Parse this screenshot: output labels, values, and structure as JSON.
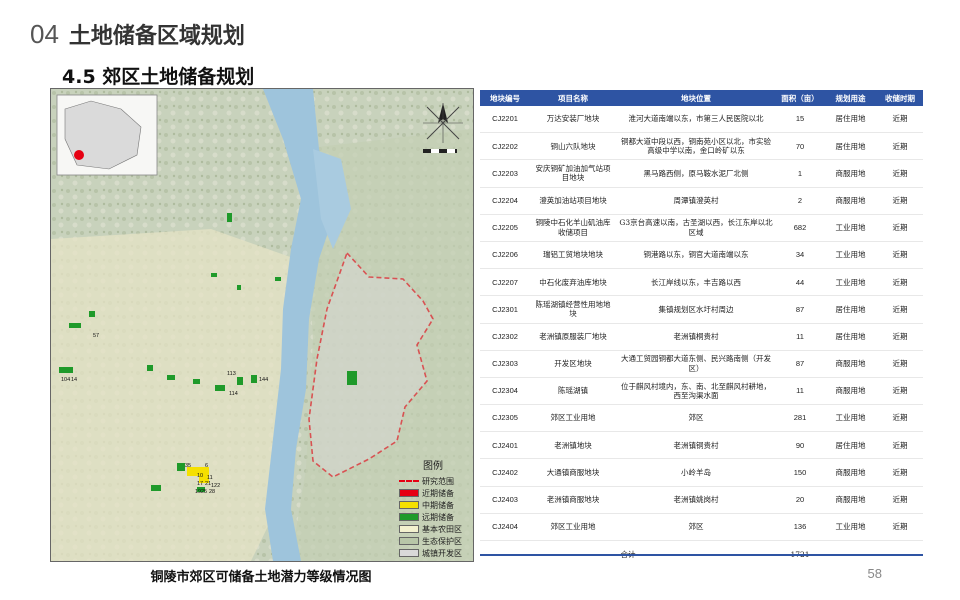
{
  "header": {
    "section_number": "04",
    "section_title": "土地储备区域规划",
    "subtitle": "4.5 郊区土地储备规划"
  },
  "map": {
    "caption": "铜陵市郊区可储备土地潜力等级情况图",
    "parcel_labels": [
      "35",
      "6",
      "10",
      "11",
      "17",
      "21",
      "19",
      "122",
      "25",
      "28",
      "14",
      "104",
      "113",
      "114",
      "57",
      "144"
    ],
    "legend": {
      "title": "图例",
      "items": [
        {
          "label": "研究范围",
          "color": "#e60012",
          "style": "dashed"
        },
        {
          "label": "近期储备",
          "color": "#e60012",
          "style": "fill"
        },
        {
          "label": "中期储备",
          "color": "#f5e000",
          "style": "fill"
        },
        {
          "label": "远期储备",
          "color": "#1f9a2a",
          "style": "fill"
        },
        {
          "label": "基本农田区",
          "color": "#f3f1cf",
          "style": "fill"
        },
        {
          "label": "生态保护区",
          "color": "#b8c6a8",
          "style": "fill"
        },
        {
          "label": "城镇开发区",
          "color": "#d9d9d9",
          "style": "fill"
        }
      ]
    }
  },
  "table": {
    "headers": [
      "地块编号",
      "项目名称",
      "地块位置",
      "面积（亩）",
      "规划用途",
      "收储时期"
    ],
    "rows": [
      {
        "code": "CJ2201",
        "name": "万达安装厂地块",
        "location": "淮河大道南端以东，市第三人民医院以北",
        "area": "15",
        "use": "居住用地",
        "period": "近期"
      },
      {
        "code": "CJ2202",
        "name": "铜山六队地块",
        "location": "铜都大道中段以西，铜南苑小区以北，市实验高级中学以南，金口岭矿以东",
        "area": "70",
        "use": "居住用地",
        "period": "近期"
      },
      {
        "code": "CJ2203",
        "name": "安庆铜矿加油加气站项目地块",
        "location": "黑马路西侧，原马鞍水泥厂北侧",
        "area": "1",
        "use": "商服用地",
        "period": "近期"
      },
      {
        "code": "CJ2204",
        "name": "澄英加油站项目地块",
        "location": "周潭镇澄英村",
        "area": "2",
        "use": "商服用地",
        "period": "近期"
      },
      {
        "code": "CJ2205",
        "name": "铜陵中石化羊山矶油库收储项目",
        "location": "G3京台高速以南，古圣湖以西，长江东岸以北区域",
        "area": "682",
        "use": "工业用地",
        "period": "近期"
      },
      {
        "code": "CJ2206",
        "name": "瑞铝工贸地块地块",
        "location": "铜港路以东，铜官大道南端以东",
        "area": "34",
        "use": "工业用地",
        "period": "近期"
      },
      {
        "code": "CJ2207",
        "name": "中石化废弃油库地块",
        "location": "长江岸线以东，丰吉路以西",
        "area": "44",
        "use": "工业用地",
        "period": "近期"
      },
      {
        "code": "CJ2301",
        "name": "陈瑶湖镇经营性用地地块",
        "location": "集镇规划区水圩村周边",
        "area": "87",
        "use": "居住用地",
        "period": "近期"
      },
      {
        "code": "CJ2302",
        "name": "老洲镇原服装厂地块",
        "location": "老洲镇桐贵村",
        "area": "11",
        "use": "居住用地",
        "period": "近期"
      },
      {
        "code": "CJ2303",
        "name": "开发区地块",
        "location": "大通工贸园铜都大道东侧、民兴路南侧（开发区）",
        "area": "87",
        "use": "商服用地",
        "period": "近期"
      },
      {
        "code": "CJ2304",
        "name": "陈瑶湖镇",
        "location": "位于麒风村境内，东、南、北至麒风村耕地，西至沟渠水面",
        "area": "11",
        "use": "商服用地",
        "period": "近期"
      },
      {
        "code": "CJ2305",
        "name": "郊区工业用地",
        "location": "郊区",
        "area": "281",
        "use": "工业用地",
        "period": "近期"
      },
      {
        "code": "CJ2401",
        "name": "老洲镇地块",
        "location": "老洲镇铜贵村",
        "area": "90",
        "use": "居住用地",
        "period": "近期"
      },
      {
        "code": "CJ2402",
        "name": "大通镇商服地块",
        "location": "小岭羊岛",
        "area": "150",
        "use": "商服用地",
        "period": "近期"
      },
      {
        "code": "CJ2403",
        "name": "老洲镇商服地块",
        "location": "老洲镇姚岗村",
        "area": "20",
        "use": "商服用地",
        "period": "近期"
      },
      {
        "code": "CJ2404",
        "name": "郊区工业用地",
        "location": "郊区",
        "area": "136",
        "use": "工业用地",
        "period": "近期"
      }
    ],
    "total_label": "合计",
    "total_area": "1721"
  },
  "page_number": "58"
}
